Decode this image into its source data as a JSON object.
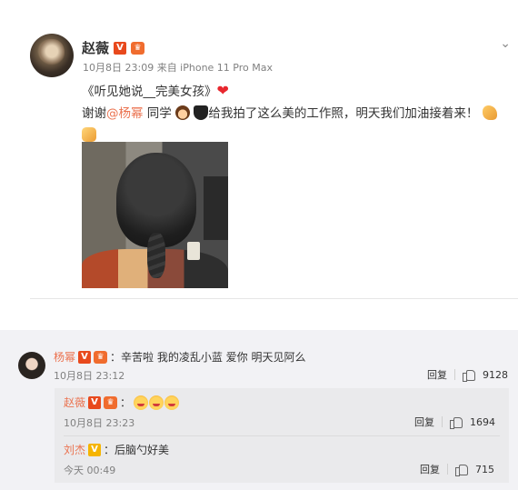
{
  "post": {
    "author": "赵薇",
    "verified_badge": "V",
    "member_badge": "crown-badge",
    "meta": "10月8日 23:09 来自 iPhone 11 Pro Max",
    "line1": "《听见她说__完美女孩》",
    "line2_prefix": "谢谢",
    "mention": "@杨幂",
    "line2_mid": " 同学",
    "line2_suffix": "给我拍了这么美的工作照，明天我们加油接着来！",
    "photo": "hair-back-photo"
  },
  "comments": [
    {
      "user": "杨幂",
      "text": "：辛苦啦 我的凌乱小蓝 爱你 明天见阿么",
      "time": "10月8日 23:12",
      "reply_label": "回复",
      "likes": "9128"
    }
  ],
  "replies": [
    {
      "user": "赵薇",
      "text": "：",
      "time": "10月8日 23:23",
      "reply_label": "回复",
      "likes": "1694"
    },
    {
      "user": "刘杰",
      "text": "：后脑勺好美",
      "time": "今天 00:49",
      "reply_label": "回复",
      "likes": "715"
    }
  ],
  "colors": {
    "link": "#eb7350",
    "badge_red": "#e8491d",
    "badge_yellow": "#f5b400",
    "comment_bg": "#f2f2f5"
  }
}
